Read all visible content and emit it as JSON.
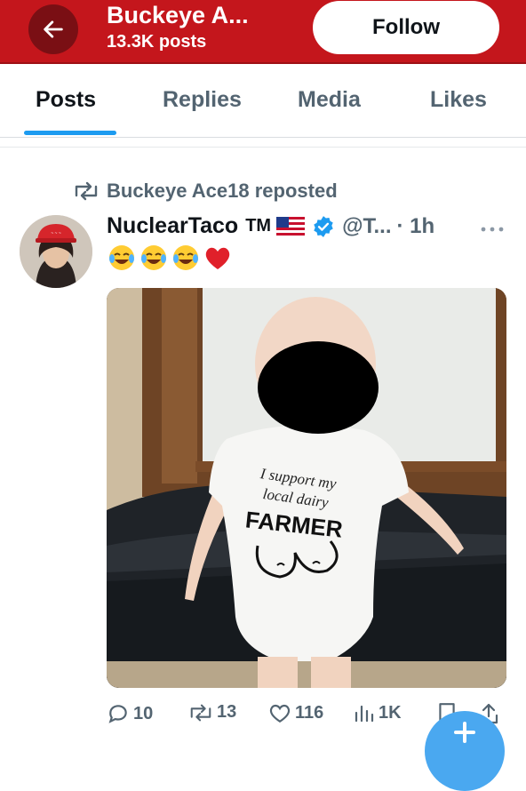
{
  "header": {
    "title": "Buckeye A...",
    "subtitle": "13.3K posts",
    "follow_label": "Follow",
    "brand_color": "#c4161c"
  },
  "tabs": [
    {
      "label": "Posts",
      "active": true
    },
    {
      "label": "Replies",
      "active": false
    },
    {
      "label": "Media",
      "active": false
    },
    {
      "label": "Likes",
      "active": false
    }
  ],
  "post": {
    "repost_label": "Buckeye Ace18 reposted",
    "author_name": "NuclearTaco",
    "tm": "TM",
    "handle": "@T...",
    "time": "· 1h",
    "emojis": [
      "😂",
      "😂",
      "😂",
      "❤️"
    ],
    "onesie_text": [
      "I support my",
      "local dairy",
      "FARMER"
    ],
    "actions": {
      "replies": "10",
      "reposts": "13",
      "likes": "116",
      "views": "1K"
    }
  },
  "icons": {
    "back": "arrow-left-icon",
    "repost": "repost-icon",
    "verified": "verified-badge-icon",
    "flag": "us-flag-icon",
    "more": "more-dots-icon",
    "reply": "reply-icon",
    "like": "heart-icon",
    "views": "views-icon",
    "bookmark": "bookmark-icon",
    "share": "share-icon"
  }
}
